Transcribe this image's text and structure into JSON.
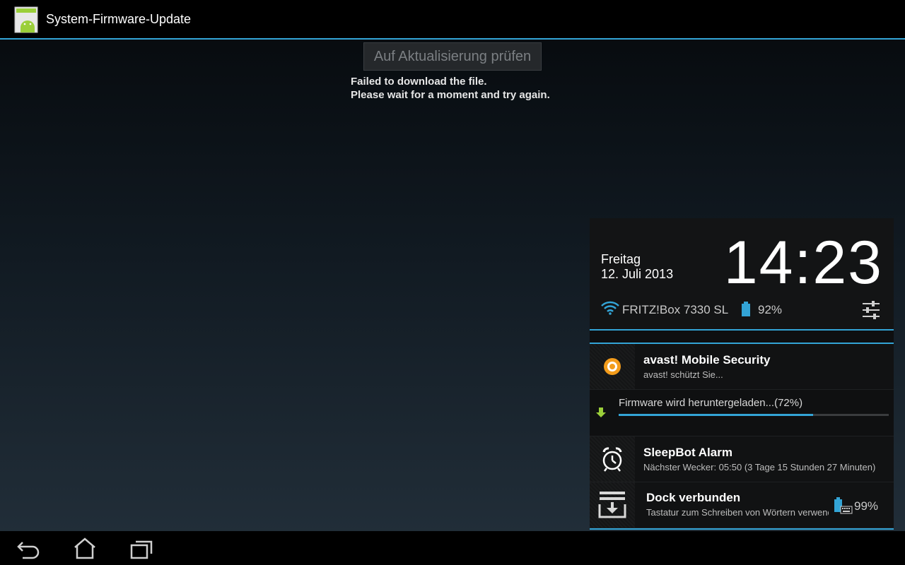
{
  "action_bar": {
    "icon": "android-app-icon",
    "title": "System-Firmware-Update"
  },
  "main": {
    "check_button_label": "Auf Aktualisierung prüfen",
    "message_line1": "Failed to download the file.",
    "message_line2": "Please wait for a moment and try again."
  },
  "notification_panel": {
    "day": "Freitag",
    "date": "12. Juli 2013",
    "time": "14:23",
    "wifi_name": "FRITZ!Box 7330 SL",
    "battery_percent": "92%",
    "battery_level": 0.92,
    "notifications": [
      {
        "icon": "avast-icon",
        "title": "avast! Mobile Security",
        "subtitle": "avast! schützt Sie..."
      },
      {
        "icon": "download-arrow-icon",
        "title": "Firmware wird heruntergeladen...(72%)",
        "progress": 0.72
      },
      {
        "icon": "alarm-clock-icon",
        "title": "SleepBot Alarm",
        "subtitle": "Nächster Wecker: 05:50 (3 Tage 15 Stunden 27 Minuten)"
      },
      {
        "icon": "dock-icon",
        "title": "Dock verbunden",
        "subtitle": "Tastatur zum Schreiben von Wörtern verwenden",
        "battery_percent": "99%",
        "battery_level": 0.99
      }
    ]
  },
  "nav_bar": {
    "buttons": [
      "back-icon",
      "home-icon",
      "recent-apps-icon"
    ]
  },
  "colors": {
    "accent": "#33a4d6",
    "progress_fill": "#33a4d6",
    "download_green": "#9bcf3a",
    "avast_orange": "#f39c1b"
  }
}
